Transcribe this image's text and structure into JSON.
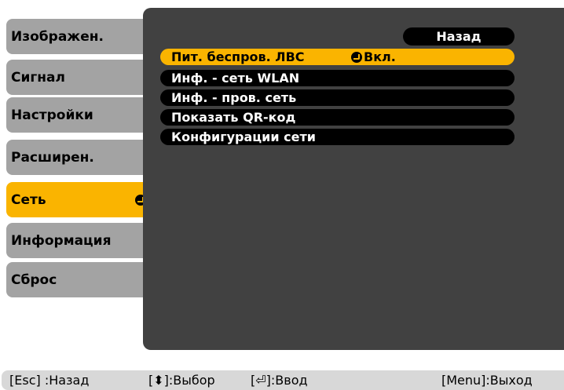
{
  "tabs": [
    {
      "label": "Изображен."
    },
    {
      "label": "Сигнал"
    },
    {
      "label": "Настройки"
    },
    {
      "label": "Расширен."
    },
    {
      "label": "Сеть",
      "active": true
    },
    {
      "label": "Информация"
    },
    {
      "label": "Сброс"
    }
  ],
  "panel": {
    "back_label": "Назад",
    "items": [
      {
        "label": "Пит. беспров. ЛВС",
        "value": "Вкл.",
        "selected": true
      },
      {
        "label": "Инф. - сеть WLAN"
      },
      {
        "label": "Инф. - пров. сеть"
      },
      {
        "label": "Показать QR-код"
      },
      {
        "label": "Конфигурации сети"
      }
    ]
  },
  "help": {
    "esc": "[Esc] :Назад",
    "select": "[⬍]:Выбор",
    "enter": "[⏎]:Ввод",
    "menu": "[Menu]:Выход"
  },
  "colors": {
    "accent": "#fab400",
    "tab": "#a3a3a3",
    "panel": "#414141",
    "item": "#000000"
  }
}
